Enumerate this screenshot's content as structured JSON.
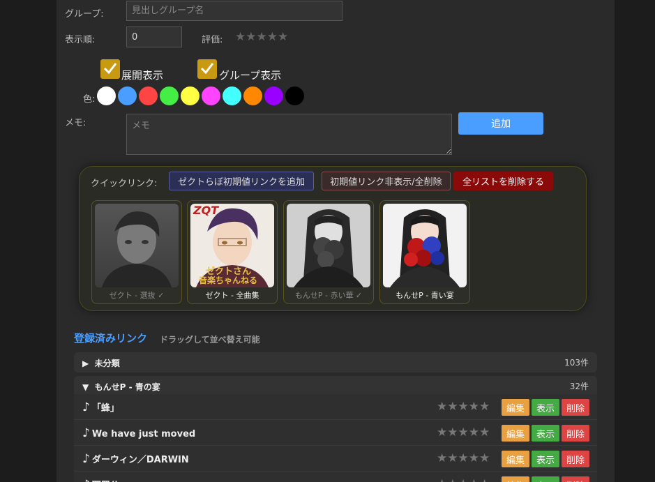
{
  "form": {
    "group_label": "グループ:",
    "group_placeholder": "見出しグループ名",
    "order_label": "表示順:",
    "order_value": "0",
    "rating_label": "評価:",
    "rating_stars": "★★★★★",
    "expand_label": "展開表示",
    "group_display_label": "グループ表示",
    "color_label": "色:",
    "colors": [
      "#ffffff",
      "#4a9eff",
      "#ff4444",
      "#44ee44",
      "#ffff44",
      "#ff44ff",
      "#44ffff",
      "#ff8800",
      "#9900ff",
      "#000000"
    ],
    "memo_label": "メモ:",
    "memo_placeholder": "メモ",
    "add_button": "追加"
  },
  "quicklink": {
    "label": "クイックリンク:",
    "add_default": "ゼクトらぼ初期値リンクを追加",
    "hide_default": "初期値リンク非表示/全削除",
    "delete_all": "全リストを削除する",
    "cards": [
      {
        "caption": "ゼクト - 選抜 ✓",
        "dim": true
      },
      {
        "caption": "ゼクト - 全曲集",
        "dim": false
      },
      {
        "caption": "もんせP - 赤い華 ✓",
        "dim": true
      },
      {
        "caption": "もんせP - 青い宴",
        "dim": false
      }
    ],
    "card2_overlay_top": "ZQT",
    "card2_overlay_line1": "ゼクトさん",
    "card2_overlay_line2": "音楽ちゃんねる"
  },
  "registered": {
    "title": "登録済みリンク",
    "subtitle": "ドラッグして並べ替え可能"
  },
  "groups": [
    {
      "arrow": "▶",
      "name": "未分類",
      "count": "103件"
    },
    {
      "arrow": "▼",
      "name": "もんせP - 青の宴",
      "count": "32件"
    }
  ],
  "rows": [
    {
      "note": "♪",
      "title": "「蜂」"
    },
    {
      "note": "♪",
      "title": "We have just moved"
    },
    {
      "note": "♪",
      "title": "ダーウィン／DARWIN"
    },
    {
      "note": "♪",
      "title": "耶罗公"
    }
  ],
  "row_actions": {
    "stars": "★★★★★",
    "edit": "編集",
    "show": "表示",
    "delete": "削除"
  }
}
